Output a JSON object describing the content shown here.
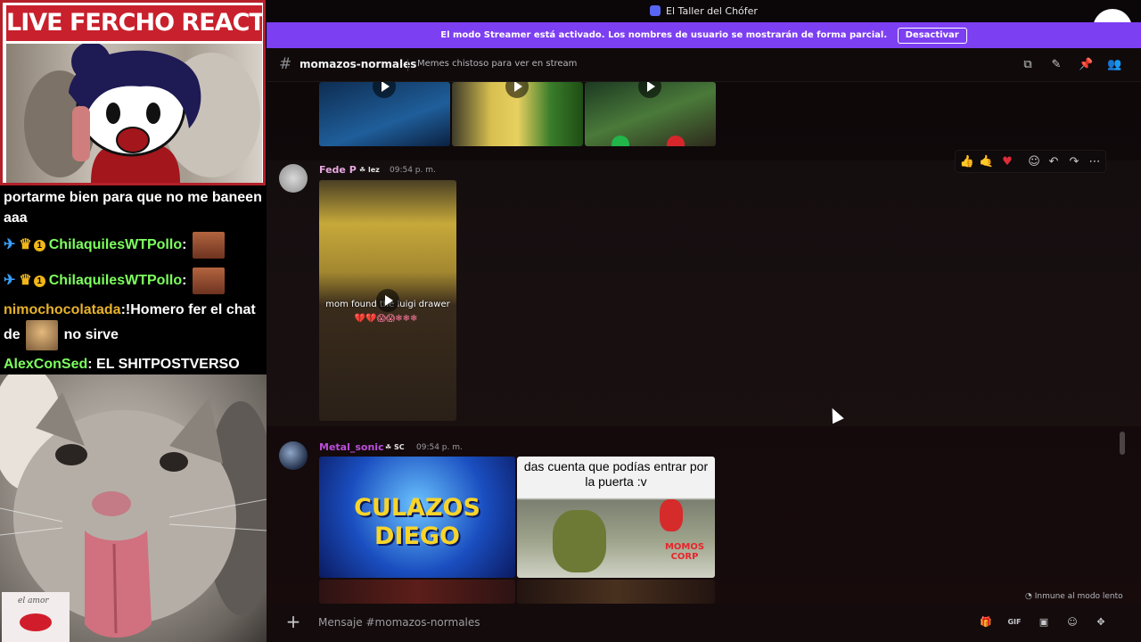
{
  "overlay": {
    "cam_title": "LIVE FERCHO REACTION",
    "chat": [
      {
        "user": "",
        "text": "portarme bien para que no me baneen aaa"
      },
      {
        "user": "ChilaquilesWTPollo",
        "text": ":"
      },
      {
        "user": "ChilaquilesWTPollo",
        "text": ":"
      },
      {
        "user": "nimochocolatada",
        "text_before": ":!Homero fer el chat de",
        "text_after": "no sirve"
      },
      {
        "user": "AlexConSed",
        "text": ": EL SHITPOSTVERSO"
      }
    ],
    "cat_signature": "el amor"
  },
  "discord": {
    "window_title": "El Taller del Chófer",
    "streamer_banner": "El modo Streamer está activado. Los nombres de usuario se mostrarán de forma parcial.",
    "streamer_button": "Desactivar",
    "channel": {
      "name": "momazos-normales",
      "topic": "Memes chistoso para ver en stream"
    },
    "messages": [
      {
        "author": "Fede P",
        "tag": "lez",
        "time": "09:54 p. m.",
        "author_color": "#e8a8e0",
        "caption": "mom found the luigi drawer"
      },
      {
        "author": "Metal_sonic",
        "tag": "SC",
        "time": "09:54 p. m.",
        "author_color": "#b94fd8",
        "thumb1_text_1": "CULAZOS",
        "thumb1_text_2": "DIEGO",
        "thumb2_text": "das cuenta que podías entrar por la puerta :v",
        "thumb2_logo": "MOMOS CORP"
      }
    ],
    "reactions": [
      "thumbs-up",
      "thumbs-up-hand",
      "heart",
      "add-reaction",
      "reply",
      "forward",
      "more"
    ],
    "slowmode_note": "Inmune al modo lento",
    "composer_placeholder": "Mensaje #momazos-normales"
  }
}
